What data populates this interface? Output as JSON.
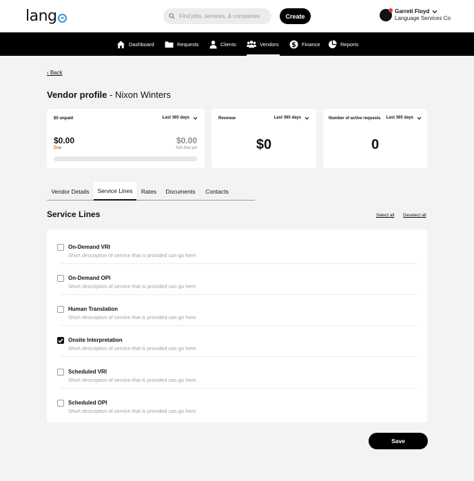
{
  "header": {
    "logo_text": "lang",
    "search_placeholder": "Find jobs, services, & companies",
    "create_label": "Create",
    "user_name": "Garrett Floyd",
    "user_org": "Language Services Co"
  },
  "nav": {
    "items": [
      {
        "label": "Dashboard",
        "icon": "home-icon"
      },
      {
        "label": "Requests",
        "icon": "folder-icon"
      },
      {
        "label": "Clients",
        "icon": "person-icon"
      },
      {
        "label": "Vendors",
        "icon": "people-icon",
        "active": true
      },
      {
        "label": "Finance",
        "icon": "dollar-icon"
      },
      {
        "label": "Reports",
        "icon": "pie-chart-icon"
      }
    ]
  },
  "page": {
    "back_label": "‹ Back",
    "title_bold": "Vendor profile",
    "title_rest": "- Nixon Winters"
  },
  "cards": {
    "unpaid": {
      "label": "$0 unpaid",
      "period": "Last 365 days",
      "due_amount": "$0.00",
      "due_label": "Due",
      "not_due_amount": "$0.00",
      "not_due_label": "Not due yet",
      "progress": 0
    },
    "revenue": {
      "label": "Revenue",
      "period": "Last 365 days",
      "value": "$0"
    },
    "active_requests": {
      "label": "Number of active requests",
      "period": "Last 365 days",
      "value": "0"
    }
  },
  "tabs": [
    {
      "label": "Vendor Details"
    },
    {
      "label": "Service Lines",
      "active": true
    },
    {
      "label": "Rates"
    },
    {
      "label": "Documents"
    },
    {
      "label": "Contacts"
    }
  ],
  "service_lines": {
    "title": "Service Lines",
    "select_all": "Select all",
    "deselect_all": "Deselect all",
    "items": [
      {
        "name": "On-Demand VRI",
        "description": "Short description of service that is provided can go here.",
        "checked": false
      },
      {
        "name": "On-Demand OPI",
        "description": "Short description of service that is provided can go here.",
        "checked": false
      },
      {
        "name": "Human Translation",
        "description": "Short description of service that is provided can go here.",
        "checked": false
      },
      {
        "name": "Onsite Interpretation",
        "description": "Short description of service that is provided can go here.",
        "checked": true
      },
      {
        "name": "Scheduled VRI",
        "description": "Short description of service that is provided can go here.",
        "checked": false
      },
      {
        "name": "Scheduled OPI",
        "description": "Short description of service that is provided can go here.",
        "checked": false
      }
    ]
  },
  "save_label": "Save",
  "colors": {
    "accent_logo": "#2f9ad6",
    "due_orange": "#e46a14",
    "notification_red": "#e53935"
  }
}
